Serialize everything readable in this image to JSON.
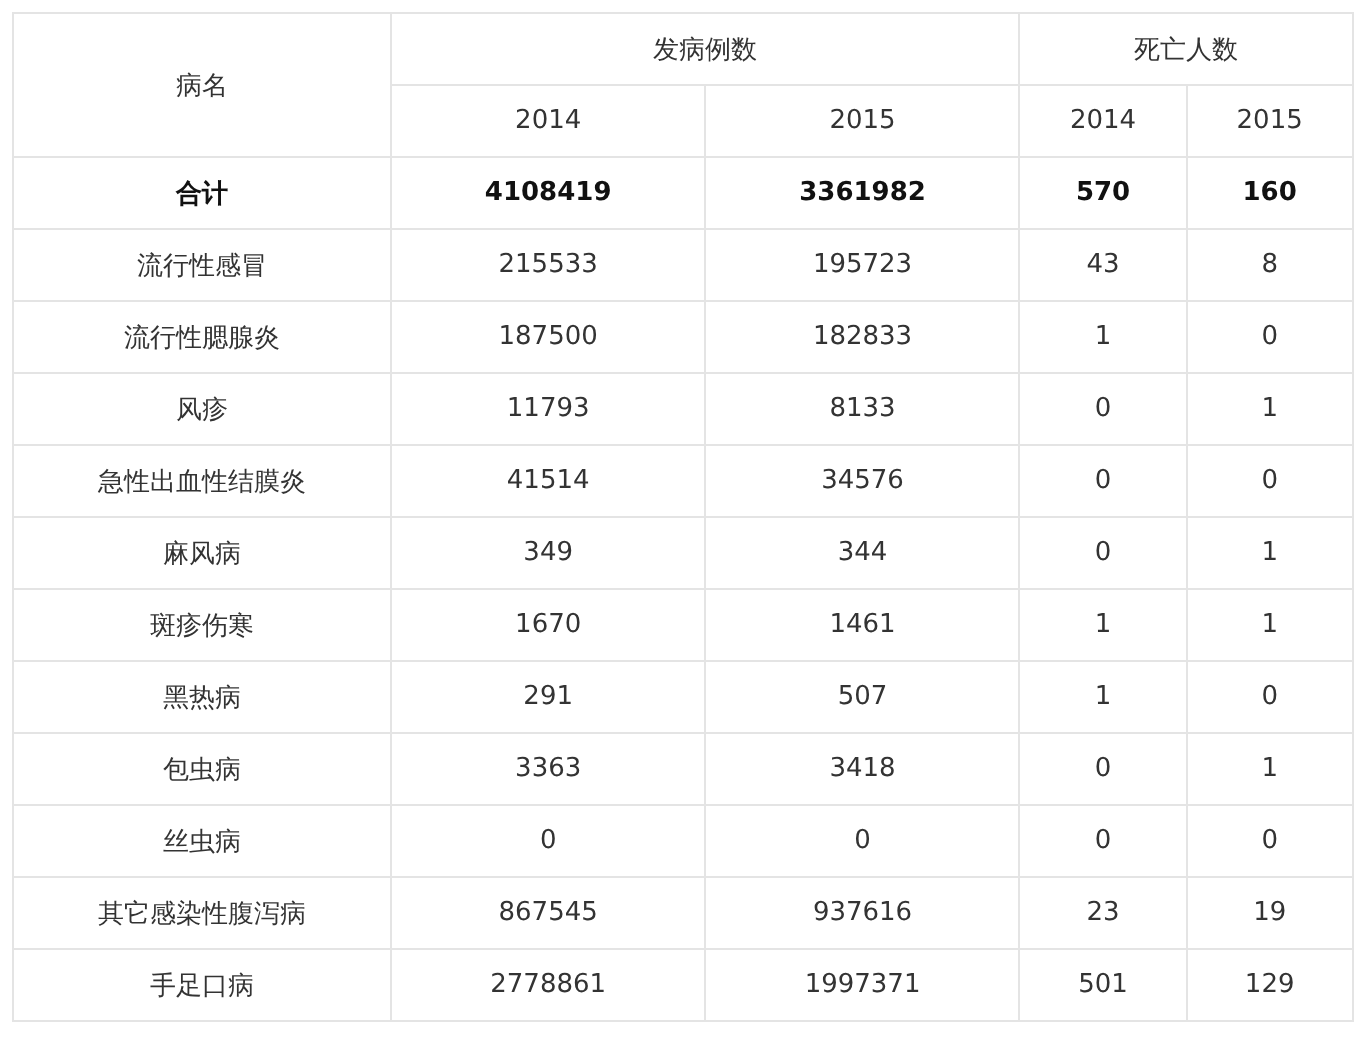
{
  "table": {
    "name_header": "病名",
    "groups": [
      {
        "label": "发病例数",
        "years": [
          "2014",
          "2015"
        ]
      },
      {
        "label": "死亡人数",
        "years": [
          "2014",
          "2015"
        ]
      }
    ],
    "rows": [
      {
        "kind": "total",
        "name": "合计",
        "cells": [
          "4108419",
          "3361982",
          "570",
          "160"
        ]
      },
      {
        "kind": "normal",
        "name": "流行性感冒",
        "cells": [
          "215533",
          "195723",
          "43",
          "8"
        ]
      },
      {
        "kind": "normal",
        "name": "流行性腮腺炎",
        "cells": [
          "187500",
          "182833",
          "1",
          "0"
        ]
      },
      {
        "kind": "normal",
        "name": "风疹",
        "cells": [
          "11793",
          "8133",
          "0",
          "1"
        ]
      },
      {
        "kind": "normal",
        "name": "急性出血性结膜炎",
        "cells": [
          "41514",
          "34576",
          "0",
          "0"
        ]
      },
      {
        "kind": "normal",
        "name": "麻风病",
        "cells": [
          "349",
          "344",
          "0",
          "1"
        ]
      },
      {
        "kind": "normal",
        "name": "斑疹伤寒",
        "cells": [
          "1670",
          "1461",
          "1",
          "1"
        ]
      },
      {
        "kind": "normal",
        "name": "黑热病",
        "cells": [
          "291",
          "507",
          "1",
          "0"
        ]
      },
      {
        "kind": "normal",
        "name": "包虫病",
        "cells": [
          "3363",
          "3418",
          "0",
          "1"
        ]
      },
      {
        "kind": "normal",
        "name": "丝虫病",
        "cells": [
          "0",
          "0",
          "0",
          "0"
        ]
      },
      {
        "kind": "normal",
        "name": "其它感染性腹泻病",
        "cells": [
          "867545",
          "937616",
          "23",
          "19"
        ]
      },
      {
        "kind": "normal",
        "name": "手足口病",
        "cells": [
          "2778861",
          "1997371",
          "501",
          "129"
        ]
      }
    ]
  }
}
